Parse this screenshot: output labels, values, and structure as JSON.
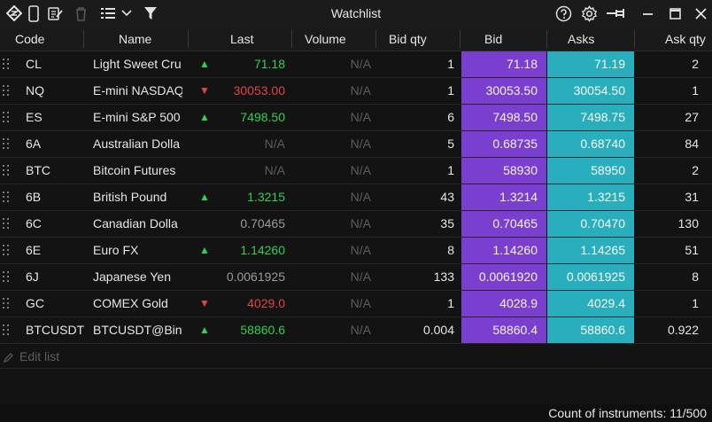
{
  "window": {
    "title": "Watchlist",
    "icons": [
      "app-logo-icon",
      "phone-icon",
      "edit-sheet-icon",
      "trash-icon",
      "list-menu-icon",
      "chevron-down-icon",
      "filter-icon",
      "help-icon",
      "gear-icon",
      "pin-icon",
      "minimize-icon",
      "maximize-icon",
      "close-icon"
    ]
  },
  "columns": {
    "code": "Code",
    "name": "Name",
    "last": "Last",
    "volume": "Volume",
    "bid_qty": "Bid qty",
    "bid": "Bid",
    "asks": "Asks",
    "ask_qty": "Ask qty"
  },
  "colors": {
    "bid_bg": "#7a3fcf",
    "ask_bg": "#29aebd",
    "up": "#2fd14f",
    "down": "#e34444"
  },
  "rows": [
    {
      "code": "CL",
      "name": "Light Sweet Cru",
      "trend": "up",
      "arrow": "▲",
      "last": "71.18",
      "last_style": "up",
      "volume": "N/A",
      "bid_qty": "1",
      "bid": "71.18",
      "ask": "71.19",
      "ask_qty": "2"
    },
    {
      "code": "NQ",
      "name": "E-mini NASDAQ",
      "trend": "down",
      "arrow": "▼",
      "last": "30053.00",
      "last_style": "down",
      "volume": "N/A",
      "bid_qty": "1",
      "bid": "30053.50",
      "ask": "30054.50",
      "ask_qty": "1"
    },
    {
      "code": "ES",
      "name": "E-mini S&P 500",
      "trend": "up",
      "arrow": "▲",
      "last": "7498.50",
      "last_style": "up",
      "volume": "N/A",
      "bid_qty": "6",
      "bid": "7498.50",
      "ask": "7498.75",
      "ask_qty": "27"
    },
    {
      "code": "6A",
      "name": "Australian Dolla",
      "trend": "none",
      "arrow": "",
      "last": "N/A",
      "last_style": "na",
      "volume": "N/A",
      "bid_qty": "5",
      "bid": "0.68735",
      "ask": "0.68740",
      "ask_qty": "84"
    },
    {
      "code": "BTC",
      "name": "Bitcoin Futures",
      "trend": "none",
      "arrow": "",
      "last": "N/A",
      "last_style": "na",
      "volume": "N/A",
      "bid_qty": "1",
      "bid": "58930",
      "ask": "58950",
      "ask_qty": "2"
    },
    {
      "code": "6B",
      "name": "British Pound",
      "trend": "up",
      "arrow": "▲",
      "last": "1.3215",
      "last_style": "up",
      "volume": "N/A",
      "bid_qty": "43",
      "bid": "1.3214",
      "ask": "1.3215",
      "ask_qty": "31"
    },
    {
      "code": "6C",
      "name": "Canadian Dolla",
      "trend": "none",
      "arrow": "",
      "last": "0.70465",
      "last_style": "neutral",
      "volume": "N/A",
      "bid_qty": "35",
      "bid": "0.70465",
      "ask": "0.70470",
      "ask_qty": "130"
    },
    {
      "code": "6E",
      "name": "Euro FX",
      "trend": "up",
      "arrow": "▲",
      "last": "1.14260",
      "last_style": "up",
      "volume": "N/A",
      "bid_qty": "8",
      "bid": "1.14260",
      "ask": "1.14265",
      "ask_qty": "51"
    },
    {
      "code": "6J",
      "name": "Japanese Yen",
      "trend": "none",
      "arrow": "",
      "last": "0.0061925",
      "last_style": "neutral",
      "volume": "N/A",
      "bid_qty": "133",
      "bid": "0.0061920",
      "ask": "0.0061925",
      "ask_qty": "8"
    },
    {
      "code": "GC",
      "name": "COMEX Gold",
      "trend": "down",
      "arrow": "▼",
      "last": "4029.0",
      "last_style": "down",
      "volume": "N/A",
      "bid_qty": "1",
      "bid": "4028.9",
      "ask": "4029.4",
      "ask_qty": "1"
    },
    {
      "code": "BTCUSDT",
      "name": "BTCUSDT@Bina",
      "trend": "up",
      "arrow": "▲",
      "last": "58860.6",
      "last_style": "up",
      "volume": "N/A",
      "bid_qty": "0.004",
      "bid": "58860.4",
      "ask": "58860.6",
      "ask_qty": "0.922"
    }
  ],
  "edit_list": {
    "label": "Edit list"
  },
  "status": {
    "count_text": "Count of instruments: 11/500"
  }
}
